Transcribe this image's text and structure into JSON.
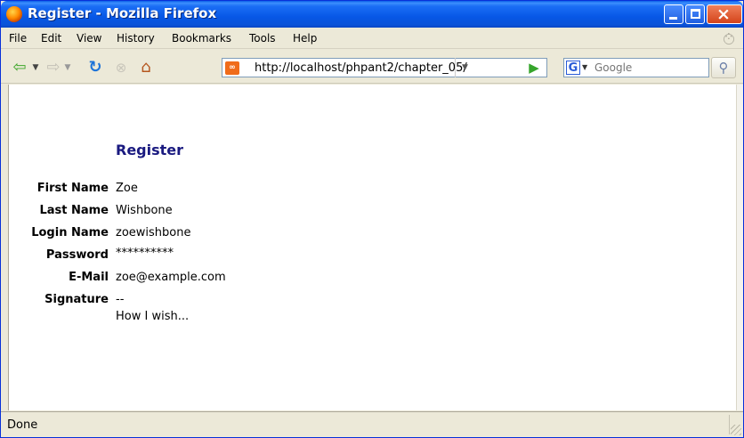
{
  "window": {
    "title": "Register - Mozilla Firefox"
  },
  "titlebar": {
    "min_label": "_",
    "max_label": "□",
    "close_label": "×"
  },
  "menu": {
    "items": [
      "File",
      "Edit",
      "View",
      "History",
      "Bookmarks",
      "Tools",
      "Help"
    ]
  },
  "navbar": {
    "back_icon": "back-arrow-icon",
    "forward_icon": "forward-arrow-icon",
    "reload_icon": "reload-icon",
    "stop_icon": "stop-icon",
    "home_icon": "home-icon",
    "url": "http://localhost/phpant2/chapter_05/",
    "search_placeholder": "Google",
    "search_engine": "G"
  },
  "page": {
    "heading": "Register",
    "fields": [
      {
        "label": "First Name",
        "value": "Zoe"
      },
      {
        "label": "Last Name",
        "value": "Wishbone"
      },
      {
        "label": "Login Name",
        "value": "zoewishbone"
      },
      {
        "label": "Password",
        "value": "**********"
      },
      {
        "label": "E-Mail",
        "value": "zoe@example.com"
      },
      {
        "label": "Signature",
        "value": "--"
      }
    ],
    "signature_line2": "How I wish..."
  },
  "status": {
    "text": "Done"
  },
  "colors": {
    "titlebar": "#0757e6",
    "heading": "#1a1a80",
    "chrome": "#ece9d8"
  }
}
